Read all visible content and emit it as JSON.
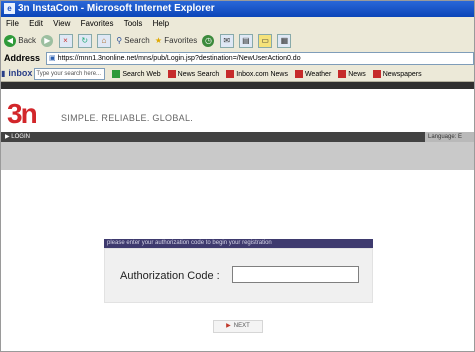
{
  "window": {
    "title": "3n InstaCom - Microsoft Internet Explorer"
  },
  "menu": [
    "File",
    "Edit",
    "View",
    "Favorites",
    "Tools",
    "Help"
  ],
  "toolbar": {
    "back": "Back",
    "search": "Search",
    "favorites": "Favorites"
  },
  "address": {
    "label": "Address",
    "url": "https://mnn1.3nonline.net/mns/pub/Login.jsp?destination=/NewUserAction0.do"
  },
  "links_bar": {
    "inbox": "inbox",
    "search_placeholder": "Type your search here...",
    "items": [
      "Search Web",
      "News Search",
      "Inbox.com News",
      "Weather",
      "News",
      "Newspapers"
    ]
  },
  "site": {
    "logo": "3n",
    "slogan": "SIMPLE. RELIABLE. GLOBAL.",
    "nav_login": "LOGIN",
    "language_label": "Language: E"
  },
  "registration": {
    "instruction": "please enter your authorization code to begin your registration",
    "auth_label": "Authorization Code :",
    "auth_value": "",
    "next_label": "NEXT"
  },
  "colors": {
    "brand_red": "#d2262a",
    "instruction_bg": "#3e3a6e",
    "xp_title_blue": "#0b45b8"
  }
}
